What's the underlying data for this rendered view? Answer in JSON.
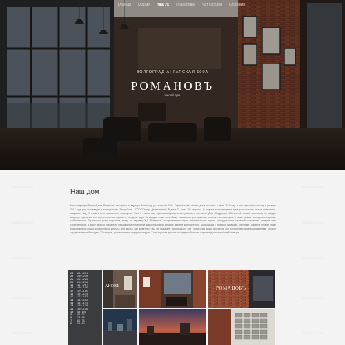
{
  "nav": {
    "items": [
      {
        "label": "Главная",
        "active": false
      },
      {
        "label": "О доме",
        "active": false
      },
      {
        "label": "Наш УК",
        "active": true
      },
      {
        "label": "Планировки",
        "active": false
      },
      {
        "label": "Чат соседей",
        "active": false
      },
      {
        "label": "Собрания",
        "active": false
      }
    ]
  },
  "hero": {
    "address": "ВОЛГОГРАД АНГАРСКАЯ 100А",
    "title": "РОМАНОВЪ",
    "tagline": "жилой дом"
  },
  "about": {
    "title": "Наш дом",
    "text": "Многоквартирный жилой дом \"Романовъ\" находится по адресу: г.Волгоград, ул.Ангарская 100а. Строительство нашего дома началось в июне 2017 года, а уже через полтора года в декабре 2018 года дом был введен в эксплуатацию. Застройщик - ООО \"Самара-Девелопмент\". В доме 21 этаж, 251 квартира. В подвальном помещении дома расположены жилые помещения-кладовые, над 23 этажом есть технические помещения. Есть 3 лифта, все грузопассажирские и все работают постоянно. Дом оборудован собственной газовой котельной, на каждую квартиру отдельные счетчики отопления, горячей и холодной воды. На каждом этаже есть общие помещения для хранения колясок и велосипедов, а также личные помещения-кладовые собственников. Территория дома огорожена, въезд на парковку ЖД \"Романовъ\" осуществляется через автоматические ворота, оборудованные системой считывания номеров авто собственников. В фойе первого этажа есть специальное помещение для консьержей, которые дежурят круглосуточно, зона отдыха с кулером, диванами, креслами. Также на первом этаже расположится общая колясочная и комната для мытья лап животных. Мы не называем лапомойкой). Все территории дома находятся под постоянным видеонаблюдением, которое осуществляется благодаря 27 камерам, установленным внутри и снаружи. У нас хорошая детская площадка и большая парковка для автомобилей жильцов."
  },
  "gallery": {
    "floors_board": [
      {
        "floor": "23",
        "apts": "241-251"
      },
      {
        "floor": "22",
        "apts": "230-240"
      },
      {
        "floor": "21",
        "apts": "219-229"
      },
      {
        "floor": "20",
        "apts": "208-218"
      },
      {
        "floor": "19",
        "apts": "197-207"
      },
      {
        "floor": "18",
        "apts": "186-196"
      },
      {
        "floor": "17",
        "apts": "175-185"
      },
      {
        "floor": "16",
        "apts": "164-174"
      },
      {
        "floor": "15",
        "apts": "153-163"
      },
      {
        "floor": "14",
        "apts": "142-152"
      },
      {
        "floor": "13",
        "apts": "131-141"
      },
      {
        "floor": "12",
        "apts": "120-130"
      },
      {
        "floor": "11",
        "apts": "109-119"
      },
      {
        "floor": "10",
        "apts": "98-108"
      },
      {
        "floor": "9",
        "apts": "87-97"
      },
      {
        "floor": "8",
        "apts": "76-86"
      },
      {
        "floor": "7",
        "apts": "65-75"
      },
      {
        "floor": "6",
        "apts": "54-64"
      }
    ],
    "sign_text": "РОМАНОВЪ",
    "wall_sign_text": "АНОВЪ"
  },
  "watermark": "ROMANOV.RU",
  "colors": {
    "page_bg": "#f3f3f3",
    "hero_dark": "#1c1613",
    "brick": "#7a3a28",
    "text": "#444444"
  }
}
